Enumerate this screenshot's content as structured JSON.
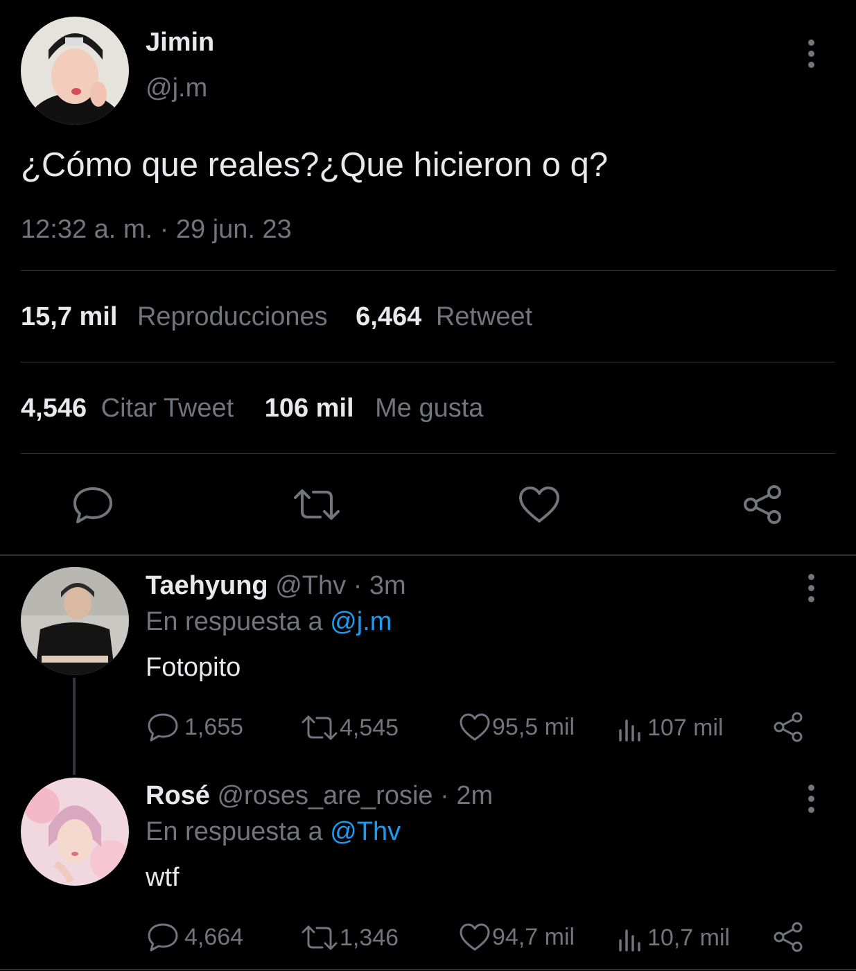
{
  "main_tweet": {
    "author_name": "Jimin",
    "author_handle": "@j.m",
    "text": "¿Cómo que reales?¿Que hicieron o q?",
    "timestamp": "12:32 a. m. · 29 jun. 23",
    "stats": {
      "views_count": "15,7 mil",
      "views_label": "Reproducciones",
      "retweets_count": "6,464",
      "retweets_label": "Retweet",
      "quotes_count": "4,546",
      "quotes_label": "Citar Tweet",
      "likes_count": "106 mil",
      "likes_label": "Me gusta"
    },
    "icons": [
      "reply-icon",
      "retweet-icon",
      "like-icon",
      "share-icon"
    ]
  },
  "replies": [
    {
      "author_name": "Taehyung",
      "author_handle": "@Thv",
      "time": "· 3m",
      "reply_prefix": "En respuesta a",
      "reply_to": "@j.m",
      "text": "Fotopito",
      "replies": "1,655",
      "retweets": "4,545",
      "likes": "95,5 mil",
      "views": "107 mil"
    },
    {
      "author_name": "Rosé",
      "author_handle": "@roses_are_rosie",
      "time": "· 2m",
      "reply_prefix": "En respuesta a",
      "reply_to": "@Thv",
      "text": "wtf",
      "replies": "4,664",
      "retweets": "1,346",
      "likes": "94,7 mil",
      "views": "10,7 mil"
    }
  ],
  "colors": {
    "background": "#000000",
    "text": "#e7e9ea",
    "secondary": "#71767b",
    "accent": "#1d9bf0",
    "divider": "#2f3336"
  }
}
